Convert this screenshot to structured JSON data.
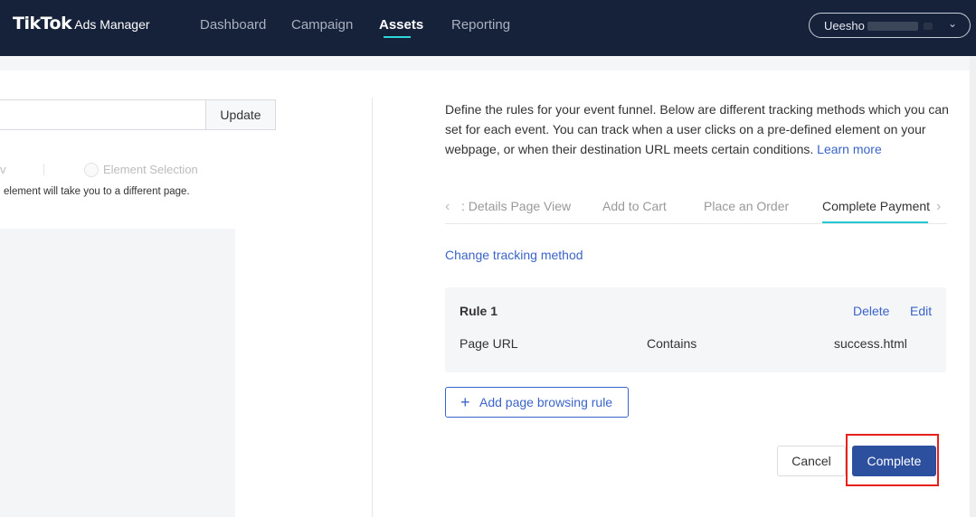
{
  "header": {
    "brand": "TikTok",
    "brand_sub": "Ads Manager",
    "nav": [
      "Dashboard",
      "Campaign",
      "Assets",
      "Reporting"
    ],
    "active_nav": "Assets",
    "account_name": "Ueesho"
  },
  "left": {
    "update_label": "Update",
    "tab_fragment": "v",
    "radio_label": "Element Selection",
    "note": "element will take you to a different page."
  },
  "right": {
    "description": "Define the rules for your event funnel. Below are different tracking methods which you can set for each event. You can track when a user clicks on a pre-defined element on your webpage, or when their destination URL meets certain conditions.",
    "learn_more": "Learn more",
    "tabs": [
      ": Details Page View",
      "Add to Cart",
      "Place an Order",
      "Complete Payment"
    ],
    "active_tab": "Complete Payment",
    "change_method": "Change tracking method",
    "rule": {
      "title": "Rule 1",
      "delete_label": "Delete",
      "edit_label": "Edit",
      "field": "Page URL",
      "operator": "Contains",
      "value": "success.html"
    },
    "add_rule_label": "Add page browsing rule",
    "cancel_label": "Cancel",
    "complete_label": "Complete"
  },
  "colors": {
    "header_bg": "#16223a",
    "accent": "#3a64c8",
    "primary_button": "#2c4f9e",
    "tab_indicator": "#22c8d4",
    "highlight": "#e6201a"
  }
}
